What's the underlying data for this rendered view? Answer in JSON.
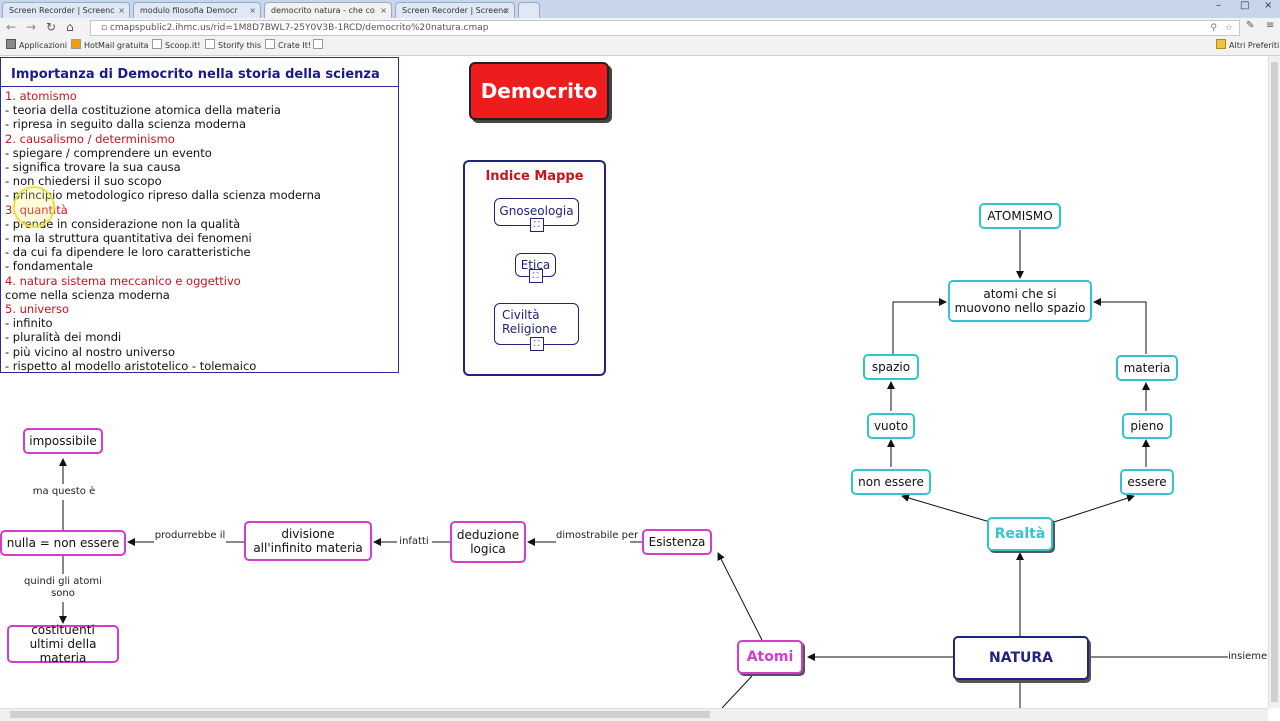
{
  "browser": {
    "tabs": [
      {
        "label": "Screen Recorder | Screenc",
        "active": false
      },
      {
        "label": "modulo filosofia Democr",
        "active": false
      },
      {
        "label": "democrito natura - che co",
        "active": true
      },
      {
        "label": "Screen Recorder | Screenc",
        "active": false
      }
    ],
    "url": "cmapspublic2.ihmc.us/rid=1M8D7BWL7-25Y0V3B-1RCD/democrito%20natura.cmap",
    "bookmarks": [
      "Applicazioni",
      "HotMail gratuita",
      "Scoop.it!",
      "Storify this",
      "Crate It!"
    ],
    "other_bookmarks": "Altri Preferiti"
  },
  "info": {
    "title": "Importanza di Democrito nella storia della scienza",
    "lines": [
      {
        "text": "1. atomismo",
        "heading": true
      },
      {
        "text": "- teoria della costituzione atomica della materia",
        "heading": false
      },
      {
        "text": "- ripresa in seguito dalla scienza moderna",
        "heading": false
      },
      {
        "text": "2. causalismo / determinismo",
        "heading": true
      },
      {
        "text": "- spiegare / comprendere un evento",
        "heading": false
      },
      {
        "text": "- significa trovare la sua causa",
        "heading": false
      },
      {
        "text": "- non chiedersi il suo scopo",
        "heading": false
      },
      {
        "text": "- principio metodologico ripreso dalla scienza moderna",
        "heading": false
      },
      {
        "text": "3. quantità",
        "heading": true
      },
      {
        "text": "- prende in considerazione non la qualità",
        "heading": false
      },
      {
        "text": "- ma la struttura quantitativa dei fenomeni",
        "heading": false
      },
      {
        "text": "- da cui fa dipendere le loro caratteristiche",
        "heading": false
      },
      {
        "text": "- fondamentale",
        "heading": false
      },
      {
        "text": "4. natura sistema meccanico e oggettivo",
        "heading": true
      },
      {
        "text": "come nella scienza moderna",
        "heading": false
      },
      {
        "text": "5. universo",
        "heading": true
      },
      {
        "text": "- infinito",
        "heading": false
      },
      {
        "text": "- pluralità dei mondi",
        "heading": false
      },
      {
        "text": "- più vicino al nostro universo",
        "heading": false
      },
      {
        "text": "- rispetto al modello aristotelico - tolemaico",
        "heading": false
      }
    ]
  },
  "title_node": "Democrito",
  "indice": {
    "title": "Indice Mappe",
    "links": [
      "Gnoseologia",
      "Etica",
      "Civiltà Religione"
    ]
  },
  "nodes": {
    "atomismo": "ATOMISMO",
    "atomi_spazio": "atomi che si muovono nello spazio",
    "spazio": "spazio",
    "materia": "materia",
    "vuoto": "vuoto",
    "pieno": "pieno",
    "non_essere": "non essere",
    "essere": "essere",
    "realta": "Realtà",
    "natura": "NATURA",
    "atomi": "Atomi",
    "esistenza": "Esistenza",
    "deduzione": "deduzione logica",
    "divisione": "divisione all'infinito materia",
    "nulla": "nulla = non essere",
    "impossibile": "impossibile",
    "costituenti": "costituenti ultimi della materia"
  },
  "link_labels": {
    "dimostrabile": "dimostrabile per",
    "infatti": "infatti",
    "produrrebbe": "produrrebbe il",
    "ma_questo": "ma questo è",
    "quindi": "quindi gli atomi sono",
    "insieme": "insieme"
  }
}
